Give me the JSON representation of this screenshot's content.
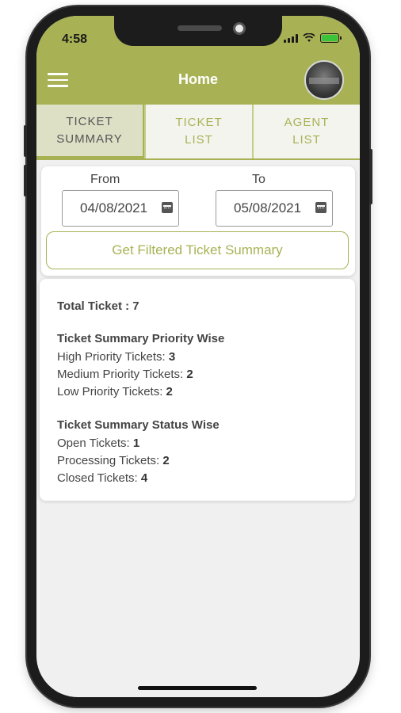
{
  "status_bar": {
    "time": "4:58",
    "icons": [
      "signal-icon",
      "wifi-icon",
      "battery-icon"
    ]
  },
  "app_bar": {
    "title": "Home",
    "menu_icon": "menu-icon",
    "avatar": "user-avatar"
  },
  "tabs": [
    {
      "line1": "TICKET",
      "line2": "SUMMARY",
      "active": true
    },
    {
      "line1": "TICKET",
      "line2": "LIST",
      "active": false
    },
    {
      "line1": "AGENT",
      "line2": "LIST",
      "active": false
    }
  ],
  "filter": {
    "from_label": "From",
    "to_label": "To",
    "from_value": "04/08/2021",
    "to_value": "05/08/2021",
    "button_label": "Get Filtered Ticket Summary"
  },
  "summary": {
    "total_label": "Total Ticket : 7",
    "priority_heading": "Ticket Summary Priority Wise",
    "priority_rows": [
      {
        "label": "High Priority Tickets: ",
        "value": "3"
      },
      {
        "label": "Medium Priority Tickets: ",
        "value": "2"
      },
      {
        "label": "Low Priority Tickets: ",
        "value": "2"
      }
    ],
    "status_heading": "Ticket Summary Status Wise",
    "status_rows": [
      {
        "label": "Open Tickets: ",
        "value": "1"
      },
      {
        "label": "Processing Tickets: ",
        "value": "2"
      },
      {
        "label": "Closed Tickets: ",
        "value": "4"
      }
    ]
  },
  "colors": {
    "primary": "#a8b254",
    "active_tab_bg": "#dee0c6",
    "battery": "#3ac43a"
  }
}
